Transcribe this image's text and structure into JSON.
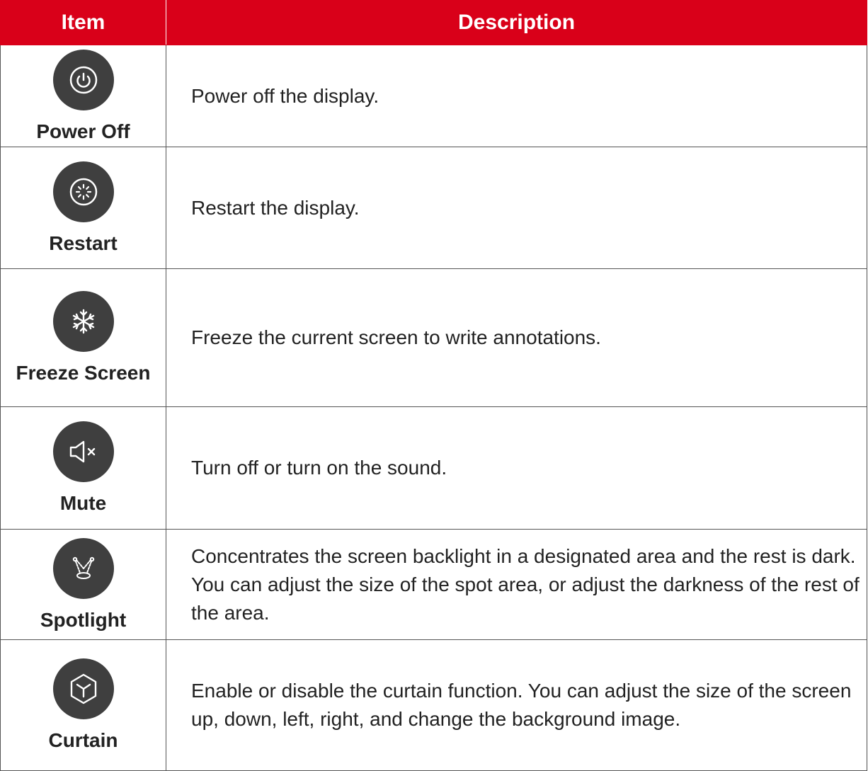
{
  "header": {
    "item": "Item",
    "description": "Description"
  },
  "rows": [
    {
      "icon": "power-icon",
      "name": "Power Off",
      "description": "Power off the display."
    },
    {
      "icon": "restart-icon",
      "name": "Restart",
      "description": "Restart the display."
    },
    {
      "icon": "snowflake-icon",
      "name": "Freeze Screen",
      "description": "Freeze the current screen to write annotations."
    },
    {
      "icon": "mute-speaker-icon",
      "name": "Mute",
      "description": "Turn off or turn on the sound."
    },
    {
      "icon": "spotlight-icon",
      "name": "Spotlight",
      "description": "Concentrates the screen backlight in a designated area and the rest is dark. You can adjust the size of the spot area, or adjust the darkness of the rest of the area."
    },
    {
      "icon": "cube-icon",
      "name": "Curtain",
      "description": "Enable or disable the curtain function. You can adjust the size of the screen up, down, left, right, and change the background image."
    }
  ],
  "colors": {
    "header_bg": "#d90019",
    "icon_bg": "#3f3f3f",
    "border": "#555555"
  }
}
